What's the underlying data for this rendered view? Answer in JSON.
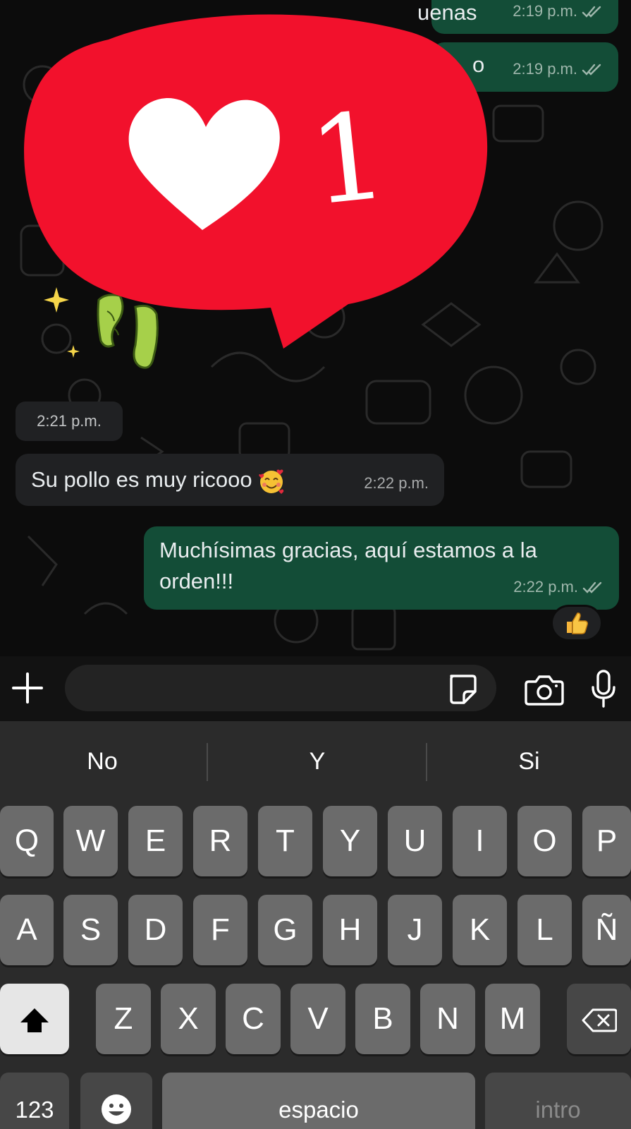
{
  "messages": [
    {
      "id": "m1",
      "direction": "outgoing",
      "text_partial": "uenas",
      "time": "2:19 p.m.",
      "status": "read"
    },
    {
      "id": "m2",
      "direction": "outgoing",
      "text_partial": "o",
      "time": "2:19 p.m.",
      "status": "read"
    },
    {
      "id": "m3",
      "direction": "incoming",
      "text": "Su pollo es muy ricooo",
      "emoji": "smiling-face-with-hearts",
      "time": "2:22 p.m."
    },
    {
      "id": "m4",
      "direction": "outgoing",
      "text": "Muchísimas gracias, aquí estamos a la orden!!!",
      "time": "2:22 p.m.",
      "status": "read",
      "reaction": "thumbs-up"
    }
  ],
  "sticker": {
    "time": "2:21 p.m."
  },
  "overlay": {
    "count": "1",
    "icon": "heart-icon",
    "color": "#f2112c"
  },
  "composer": {
    "placeholder": "",
    "value": ""
  },
  "keyboard": {
    "suggestions": [
      "No",
      "Y",
      "Si"
    ],
    "row1": [
      "Q",
      "W",
      "E",
      "R",
      "T",
      "Y",
      "U",
      "I",
      "O",
      "P"
    ],
    "row2": [
      "A",
      "S",
      "D",
      "F",
      "G",
      "H",
      "J",
      "K",
      "L",
      "Ñ"
    ],
    "row3": [
      "Z",
      "X",
      "C",
      "V",
      "B",
      "N",
      "M"
    ],
    "numbers_label": "123",
    "space_label": "espacio",
    "return_label": "intro"
  },
  "colors": {
    "outgoing_bubble": "#134d37",
    "incoming_bubble": "#202123",
    "keyboard_bg": "#2b2b2b",
    "key": "#6b6b6b"
  }
}
